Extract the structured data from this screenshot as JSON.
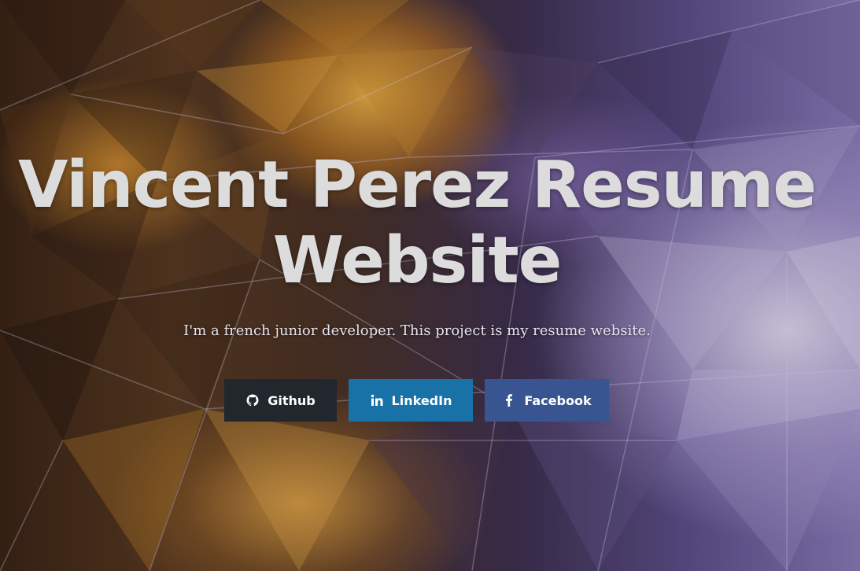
{
  "hero": {
    "title": "Vincent Perez Resume Website",
    "subtitle": "I'm a french junior developer. This project is my resume website."
  },
  "buttons": [
    {
      "label": "Github",
      "icon": "github-icon",
      "color": "#22262d"
    },
    {
      "label": "LinkedIn",
      "icon": "linkedin-icon",
      "color": "#1872a8"
    },
    {
      "label": "Facebook",
      "icon": "facebook-icon",
      "color": "#385591"
    }
  ],
  "colors": {
    "title": "#dcdcdc",
    "subtitle": "#e6e2ec"
  }
}
